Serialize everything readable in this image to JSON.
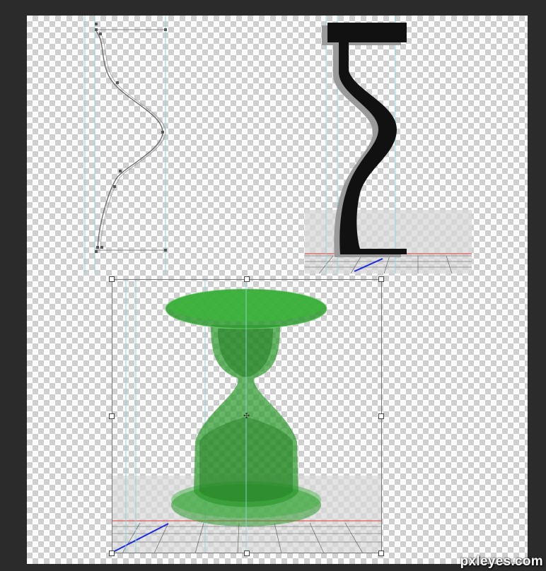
{
  "watermark": {
    "text": "pxleyes.com"
  },
  "panels": {
    "path": {
      "name": "profile-path-panel"
    },
    "extrude": {
      "name": "extruded-profile-panel"
    },
    "hourglass": {
      "name": "revolved-hourglass-panel"
    }
  },
  "colors": {
    "workspace": "#2b2b2b",
    "guide": "#8fd6dc",
    "glass": "#2e9a2e",
    "axis_blue": "#1a2be0",
    "axis_red": "#e05a5a"
  }
}
